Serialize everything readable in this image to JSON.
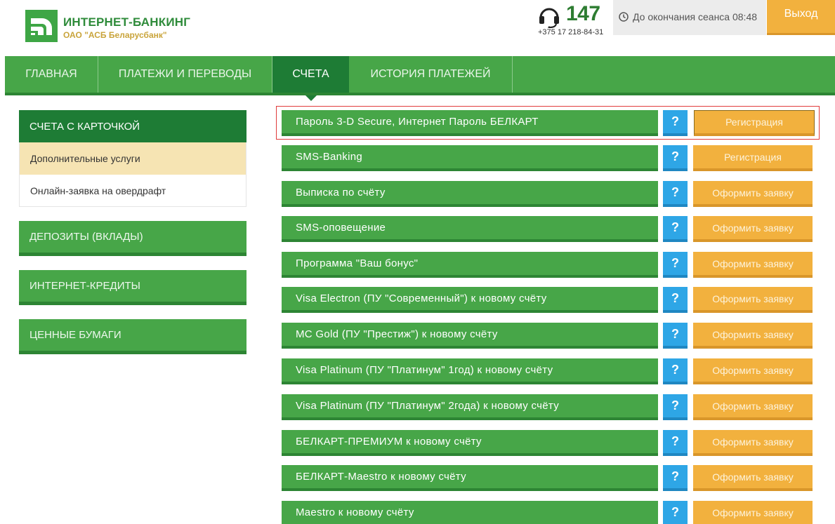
{
  "header": {
    "brand_title": "ИНТЕРНЕТ-БАНКИНГ",
    "brand_subtitle": "ОАО \"АСБ Беларусбанк\"",
    "phone_short": "147",
    "phone_full": "+375 17 218-84-31",
    "session_text": "До окончания сеанса 08:48",
    "logout_label": "Выход"
  },
  "nav": {
    "items": [
      "ГЛАВНАЯ",
      "ПЛАТЕЖИ И ПЕРЕВОДЫ",
      "СЧЕТА",
      "ИСТОРИЯ ПЛАТЕЖЕЙ"
    ],
    "active": "СЧЕТА"
  },
  "sidebar": {
    "active_panel": "СЧЕТА С КАРТОЧКОЙ",
    "sub_items": [
      "Дополнительные услуги",
      "Онлайн-заявка на овердрафт"
    ],
    "panels": [
      "ДЕПОЗИТЫ (ВКЛАДЫ)",
      "ИНТЕРНЕТ-КРЕДИТЫ",
      "ЦЕННЫЕ БУМАГИ"
    ]
  },
  "services": {
    "help_label": "?",
    "rows": [
      {
        "label": "Пароль 3-D Secure, Интернет Пароль БЕЛКАРТ",
        "action": "Регистрация"
      },
      {
        "label": "SMS-Banking",
        "action": "Регистрация"
      },
      {
        "label": "Выписка по счёту",
        "action": "Оформить заявку"
      },
      {
        "label": "SMS-оповещение",
        "action": "Оформить заявку"
      },
      {
        "label": "Программа \"Ваш бонус\"",
        "action": "Оформить заявку"
      },
      {
        "label": "Visa Electron (ПУ \"Современный\") к новому счёту",
        "action": "Оформить заявку"
      },
      {
        "label": "MC Gold (ПУ \"Престиж\") к новому счёту",
        "action": "Оформить заявку"
      },
      {
        "label": "Visa Platinum (ПУ \"Платинум\" 1год) к новому счёту",
        "action": "Оформить заявку"
      },
      {
        "label": "Visa Platinum (ПУ \"Платинум\" 2года) к новому счёту",
        "action": "Оформить заявку"
      },
      {
        "label": "БЕЛКАРТ-ПРЕМИУМ к новому счёту",
        "action": "Оформить заявку"
      },
      {
        "label": "БЕЛКАРТ-Maestro к новому счёту",
        "action": "Оформить заявку"
      },
      {
        "label": "Maestro к новому счёту",
        "action": "Оформить заявку"
      }
    ]
  },
  "icons": {
    "logo": "bank-logo-icon",
    "phone": "headset-icon",
    "clock": "clock-icon"
  },
  "colors": {
    "green": "#47a648",
    "dark_green": "#1e7c35",
    "orange": "#f2b13e",
    "blue": "#2ea6e6",
    "highlight": "#e03b3b"
  }
}
